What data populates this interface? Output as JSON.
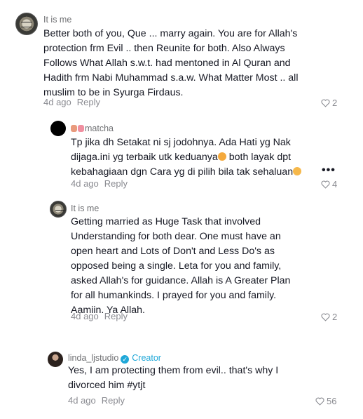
{
  "comments": [
    {
      "username": "It is me",
      "lines": [
        "Better both of you, Que ... marry again. You are for Allah's",
        "protection frm Evil .. then Reunite for both. Also Always",
        "Follows What Allah s.w.t. had mentoned in Al Quran and",
        "Hadith frm Nabi Muhammad s.a.w. What Matter Most .. all",
        "muslim to be in Syurga Firdaus."
      ],
      "time": "4d ago",
      "reply": "Reply",
      "likes": "2"
    },
    {
      "username": "matcha",
      "lines": [
        "Tp jika dh Setakat ni sj jodohnya. Ada Hati yg Nak",
        "dijaga.ini yg terbaik utk keduanya",
        " both layak dpt",
        "kebahagiaan dgn Cara yg di pilih bila tak sehaluan"
      ],
      "time": "4d ago",
      "reply": "Reply",
      "likes": "4",
      "more": "•••"
    },
    {
      "username": "It is me",
      "lines": [
        "Getting married as Huge Task that involved",
        "Understanding for both dear. One must have an",
        "open heart and Lots of Don't and Less Do's as",
        "opposed being a single. Leta for you and family,",
        "asked Allah's for guidance. Allah is A Greater Plan",
        "for all humankinds. I prayed for you and family.",
        "Aamiin. Ya Allah."
      ],
      "time": "4d ago",
      "reply": "Reply",
      "likes": "2"
    },
    {
      "username": "linda_ljstudio",
      "creator": "Creator",
      "check": "✓",
      "lines": [
        "Yes, I am protecting them from evil.. that's why I",
        "divorced him #ytjt"
      ],
      "time": "4d ago",
      "reply": "Reply",
      "likes": "56"
    }
  ]
}
